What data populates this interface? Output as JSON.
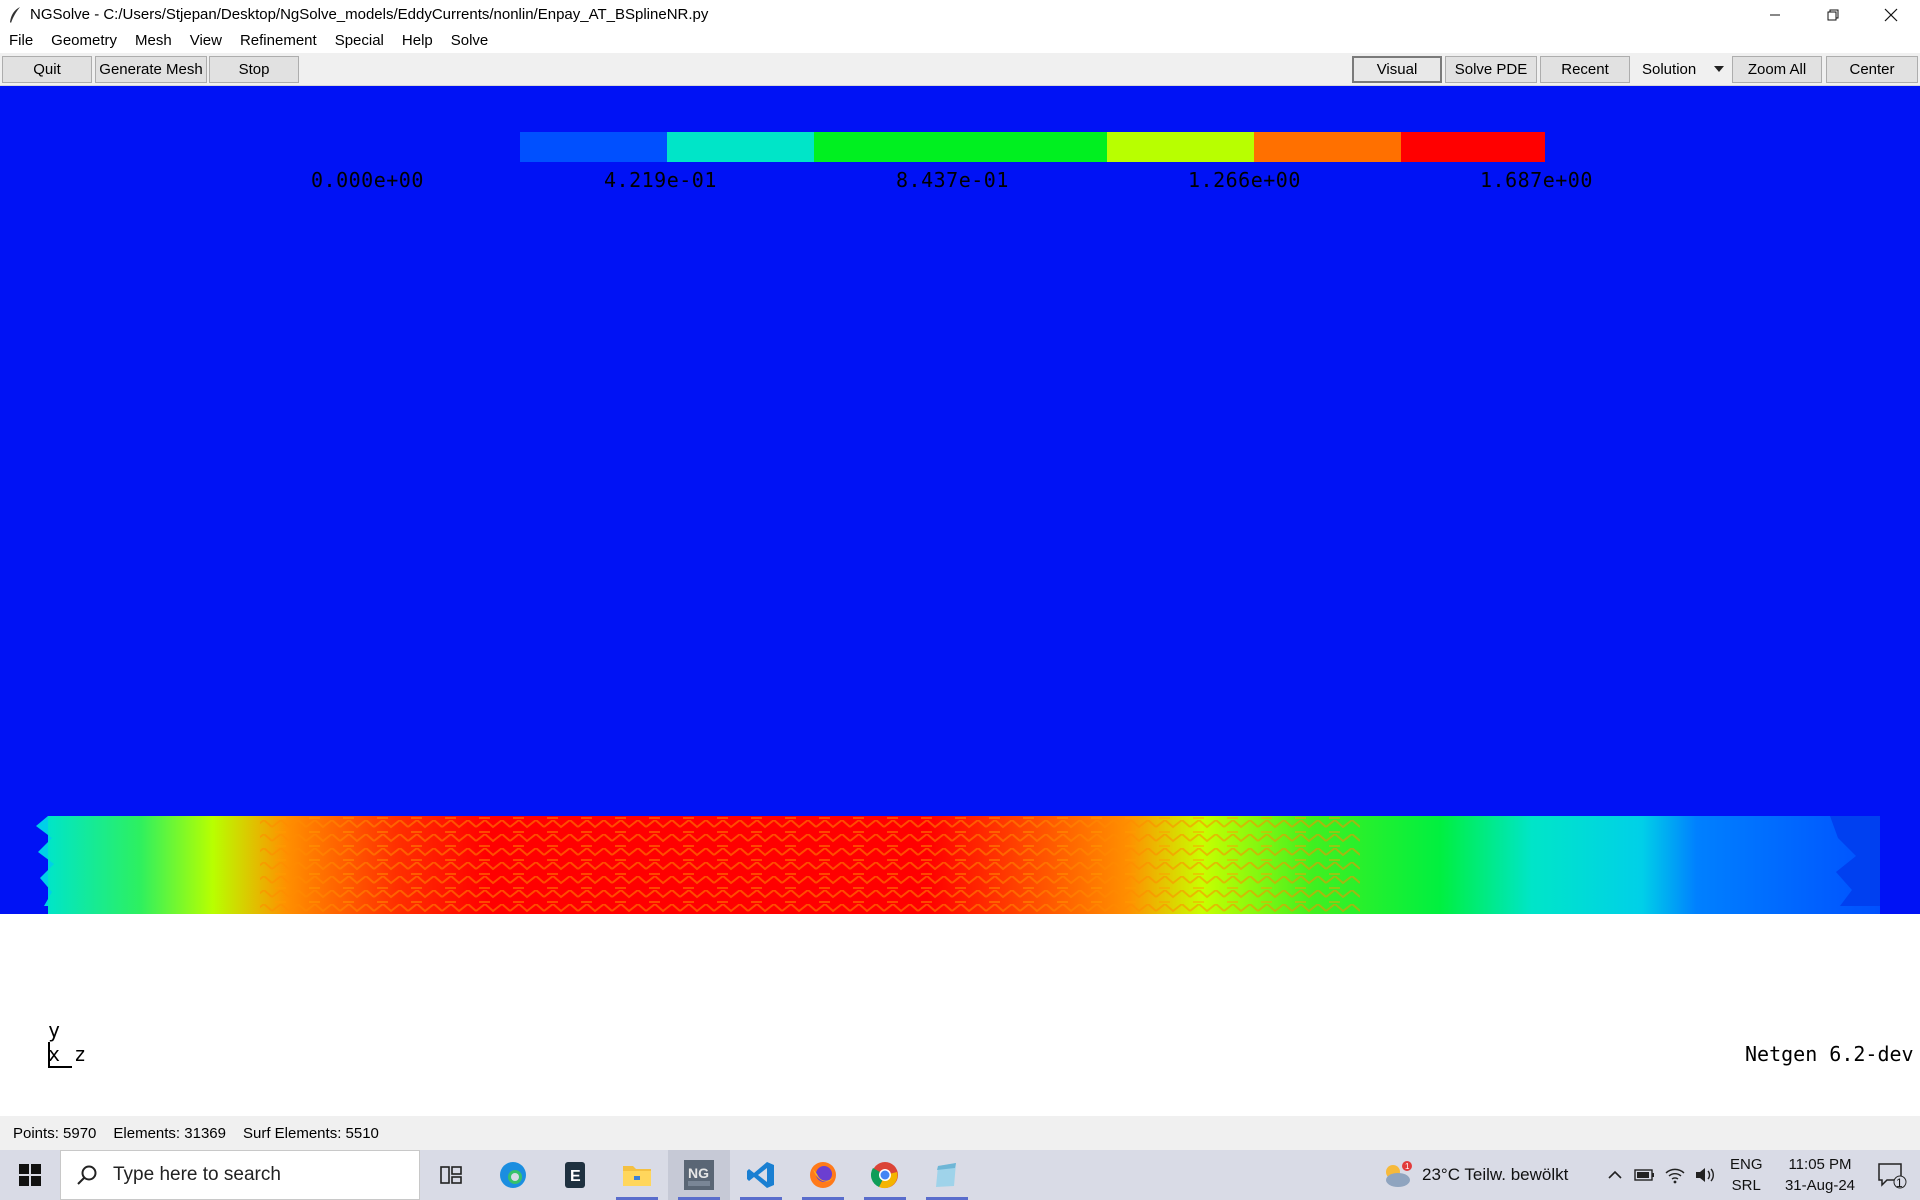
{
  "window": {
    "title": "NGSolve - C:/Users/Stjepan/Desktop/NgSolve_models/EddyCurrents/nonlin/Enpay_AT_BSplineNR.py",
    "minimize_icon": "minimize-icon",
    "maximize_icon": "restore-icon",
    "close_icon": "close-icon"
  },
  "menu": {
    "items": [
      "File",
      "Geometry",
      "Mesh",
      "View",
      "Refinement",
      "Special",
      "Help",
      "Solve"
    ]
  },
  "toolbar": {
    "left_buttons": [
      "Quit",
      "Generate Mesh",
      "Stop"
    ],
    "right_buttons": [
      "Visual",
      "Solve PDE",
      "Recent"
    ],
    "solution_select": "Solution",
    "zoom_all": "Zoom All",
    "center": "Center"
  },
  "viewport": {
    "background_color": "#0012f5",
    "colorbar": {
      "colors": [
        "#0050ff",
        "#00e5c8",
        "#00f020",
        "#b8ff00",
        "#ff7000",
        "#ff0000"
      ],
      "labels": [
        "0.000e+00",
        "4.219e-01",
        "8.437e-01",
        "1.266e+00",
        "1.687e+00"
      ]
    },
    "axes": {
      "y": "y",
      "x": "x",
      "z": "z"
    },
    "version": "Netgen 6.2-dev"
  },
  "status": {
    "points": "Points: 5970",
    "elements": "Elements: 31369",
    "surf_elements": "Surf Elements: 5510"
  },
  "taskbar": {
    "search_placeholder": "Type here to search",
    "weather": "23°C  Teilw. bewölkt",
    "language_top": "ENG",
    "language_bottom": "SRL",
    "time": "11:05 PM",
    "date": "31-Aug-24",
    "notification_count": "1"
  }
}
